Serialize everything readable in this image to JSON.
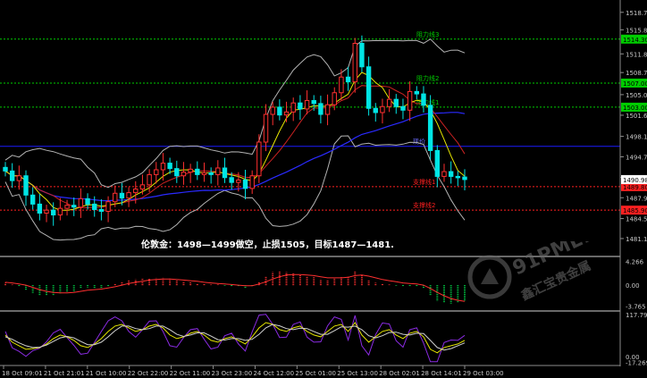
{
  "chart_data": {
    "type": "candlestick",
    "main": {
      "ylim": [
        1478.5,
        1520.5
      ],
      "y_ticks": [
        "1518.75",
        "1515.85",
        "1511.85",
        "1508.75",
        "1505.08",
        "1501.66",
        "1498.15",
        "1494.75",
        "1491.35",
        "1487.96",
        "1484.50",
        "1481.18"
      ],
      "price_label": "1490.98",
      "current_price": 1490.98,
      "horizontal_lines": [
        {
          "label": "阻力线3",
          "value": 1514.3,
          "color": "#00cc00",
          "tag": "1514.30"
        },
        {
          "label": "阻力线2",
          "value": 1507.0,
          "color": "#00cc00",
          "tag": "1507.00"
        },
        {
          "label": "阻力线1",
          "value": 1503.0,
          "color": "#00cc00",
          "tag": "1503.00"
        },
        {
          "label": "现价",
          "value": 1496.5,
          "color": "#1a1aff",
          "tag": ""
        },
        {
          "label": "支撑线1",
          "value": 1489.8,
          "color": "#ff2020",
          "tag": "1489.80"
        },
        {
          "label": "支撑线2",
          "value": 1485.9,
          "color": "#ff2020",
          "tag": "1485.90"
        }
      ],
      "closes": [
        1492.4,
        1490.8,
        1491.6,
        1488.4,
        1486.9,
        1485.4,
        1485.9,
        1485.1,
        1486.2,
        1486.7,
        1486.4,
        1487.8,
        1486.9,
        1486.0,
        1485.7,
        1487.3,
        1488.7,
        1487.9,
        1488.8,
        1489.4,
        1490.1,
        1491.8,
        1492.6,
        1493.7,
        1492.8,
        1491.6,
        1492.2,
        1492.7,
        1491.8,
        1492.1,
        1491.8,
        1492.9,
        1491.3,
        1490.5,
        1490.9,
        1489.5,
        1491.6,
        1497.2,
        1501.8,
        1503.0,
        1501.7,
        1502.2,
        1503.7,
        1502.7,
        1504.1,
        1503.6,
        1501.8,
        1503.4,
        1505.4,
        1508.0,
        1507.2,
        1513.6,
        1509.7,
        1502.8,
        1502.1,
        1503.1,
        1504.3,
        1503.1,
        1502.5,
        1505.6,
        1505.2,
        1503.3,
        1495.8,
        1491.5,
        1492.3,
        1491.5,
        1491.4,
        1490.98
      ]
    },
    "annotation": "伦敦金：1498—1499做空，止损1505，目标1487—1481.",
    "macd": {
      "y_ticks": [
        "4.266",
        "0.00",
        "-3.765"
      ],
      "ylim": [
        -4.3,
        4.8
      ],
      "hist": [
        0.4,
        0.1,
        -0.3,
        -0.9,
        -1.4,
        -1.8,
        -1.9,
        -1.8,
        -1.6,
        -1.3,
        -1.1,
        -0.6,
        -0.4,
        -0.5,
        -0.6,
        -0.2,
        0.3,
        0.6,
        0.8,
        1.0,
        1.1,
        1.2,
        1.3,
        1.3,
        1.1,
        0.8,
        0.6,
        0.5,
        0.3,
        0.2,
        0.1,
        0.1,
        -0.1,
        -0.3,
        -0.3,
        -0.5,
        -0.3,
        0.6,
        1.6,
        2.3,
        2.5,
        2.3,
        2.1,
        1.8,
        1.6,
        1.4,
        1.0,
        0.9,
        1.1,
        1.5,
        1.6,
        2.4,
        1.9,
        0.9,
        0.4,
        0.2,
        0.1,
        -0.1,
        -0.3,
        -0.2,
        -0.3,
        -0.6,
        -1.9,
        -2.9,
        -3.2,
        -3.3,
        -3.1,
        -2.9
      ],
      "signal": [
        0.5,
        0.4,
        0.2,
        0.0,
        -0.4,
        -0.8,
        -1.1,
        -1.3,
        -1.4,
        -1.4,
        -1.3,
        -1.1,
        -0.9,
        -0.8,
        -0.7,
        -0.5,
        -0.3,
        0.0,
        0.3,
        0.5,
        0.7,
        0.9,
        1.0,
        1.1,
        1.1,
        1.0,
        0.9,
        0.8,
        0.7,
        0.5,
        0.4,
        0.3,
        0.2,
        0.1,
        0.0,
        -0.1,
        -0.1,
        0.2,
        0.6,
        1.1,
        1.5,
        1.8,
        1.9,
        1.9,
        1.8,
        1.7,
        1.5,
        1.3,
        1.3,
        1.3,
        1.4,
        1.7,
        1.8,
        1.6,
        1.3,
        1.0,
        0.8,
        0.6,
        0.4,
        0.3,
        0.2,
        0.0,
        -0.6,
        -1.3,
        -1.9,
        -2.4,
        -2.7,
        -2.9
      ]
    },
    "stoch": {
      "y_ticks": [
        "117.7911",
        "0.00",
        "-17.2693"
      ],
      "ylim": [
        -18,
        120
      ],
      "k": [
        60,
        40,
        30,
        20,
        22,
        25,
        35,
        50,
        60,
        55,
        45,
        30,
        25,
        35,
        50,
        70,
        85,
        90,
        80,
        70,
        75,
        85,
        90,
        80,
        60,
        50,
        55,
        65,
        70,
        60,
        45,
        40,
        50,
        55,
        45,
        35,
        55,
        80,
        95,
        90,
        75,
        70,
        80,
        85,
        70,
        60,
        55,
        70,
        85,
        90,
        70,
        95,
        60,
        40,
        55,
        70,
        75,
        60,
        50,
        65,
        70,
        55,
        20,
        10,
        25,
        30,
        35,
        45
      ],
      "d": [
        55,
        48,
        38,
        30,
        25,
        26,
        32,
        42,
        52,
        56,
        52,
        42,
        33,
        33,
        40,
        55,
        72,
        85,
        85,
        78,
        75,
        78,
        85,
        85,
        75,
        62,
        56,
        60,
        66,
        66,
        57,
        47,
        46,
        50,
        50,
        45,
        48,
        62,
        80,
        90,
        86,
        78,
        75,
        79,
        78,
        70,
        62,
        62,
        72,
        83,
        82,
        85,
        75,
        58,
        52,
        58,
        67,
        68,
        62,
        60,
        65,
        64,
        45,
        25,
        18,
        22,
        30,
        38
      ]
    },
    "x_labels": [
      "18 Oct 09:01",
      "21 Oct 21:01",
      "21 Oct 10:00",
      "22 Oct 22:00",
      "22 Oct 11:00",
      "23 Oct 23:00",
      "24 Oct 12:00",
      "25 Oct 01:00",
      "25 Oct 13:00",
      "28 Oct 02:01",
      "28 Oct 14:01",
      "29 Oct 03:00"
    ],
    "watermark": "91PME.COM",
    "watermark_sub": "鑫汇宝贵金属"
  }
}
